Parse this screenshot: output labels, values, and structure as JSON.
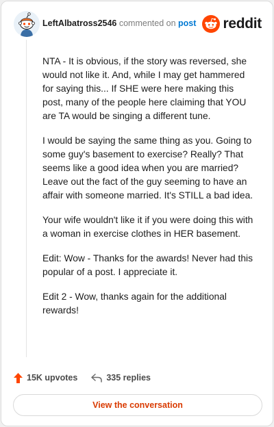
{
  "header": {
    "username": "LeftAlbatross2546",
    "commented_text": "commented on",
    "post_link": "post",
    "brand": "reddit"
  },
  "comment": {
    "paragraphs": [
      "NTA - It is obvious, if the story was reversed, she would not like it. And, while I may get hammered for saying this... If SHE were here making this post, many of the people here claiming that YOU are TA would be singing a different tune.",
      "I would be saying the same thing as you. Going to some guy's basement to exercise? Really? That seems like a good idea when you are married? Leave out the fact of the guy seeming to have an affair with someone married. It's STILL a bad idea.",
      "Your wife wouldn't like it if you were doing this with a woman in exercise clothes in HER basement.",
      "Edit: Wow - Thanks for the awards! Never had this popular of a post. I appreciate it.",
      "Edit 2 - Wow, thanks again for the additional rewards!"
    ]
  },
  "stats": {
    "upvotes": "15K upvotes",
    "replies": "335 replies"
  },
  "cta": {
    "label": "View the conversation"
  },
  "colors": {
    "brand": "#ff4500",
    "link": "#0079d3",
    "cta_text": "#d93a00"
  },
  "icons": {
    "avatar": "snoo-avatar",
    "logo": "reddit-logo-icon",
    "upvote": "upvote-arrow-icon",
    "reply": "reply-arrow-icon"
  }
}
